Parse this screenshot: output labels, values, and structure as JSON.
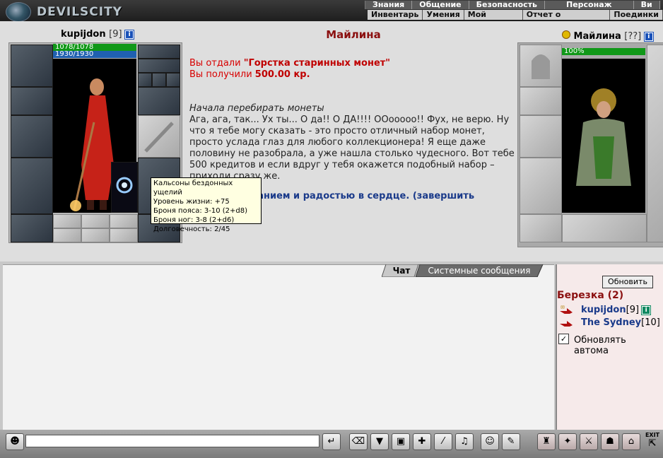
{
  "logo_text": "DEVILSCITY",
  "nav_top": [
    "Знания",
    "Общение",
    "Безопасность",
    "Персонаж",
    "Ви"
  ],
  "nav_sub": [
    "Инвентарь",
    "Умения",
    "Мой Скролл",
    "Отчет о переводах",
    "Поединки"
  ],
  "player": {
    "name": "kupijdon",
    "level": "[9]",
    "hp": "1078/1078",
    "mana": "1930/1930"
  },
  "npc": {
    "name": "Майлина",
    "level": "[??]",
    "hp_percent_label": "100%"
  },
  "tooltip": {
    "title": "Кальсоны бездонных ущелий",
    "lines": [
      "Уровень жизни: +75",
      "Броня пояса: 3-10 (2+d8)",
      "Броня ног: 3-8 (2+d6)",
      "Долговечность: 2/45"
    ]
  },
  "dialog": {
    "title": "Майлина",
    "gave_prefix": "Вы отдали ",
    "gave_item": "\"Горстка старинных монет\"",
    "got_prefix": "Вы получили ",
    "got_amount": "500.00 кр.",
    "action": "Начала перебирать монеты",
    "speech": "Ага, ага, так... Ух ты... О да!! О ДА!!!! ООооооо!! Фух, не верю. Ну что я тебе могу сказать - это просто отличный набор монет, просто услада глаз для любого коллекционера! Я еще даже половину не разобрала, а уже нашла столько чудесного. Вот тебе 500 кредитов и если вдруг у тебя окажется подобный набор – приходи сразу же.",
    "link": "ванием и радостью в сердце. (завершить"
  },
  "chat": {
    "tabs": [
      "Чат",
      "Системные сообщения"
    ]
  },
  "sidebar": {
    "refresh_label": "Обновить",
    "location": "Березка (2)",
    "users": [
      {
        "name": "kupijdon",
        "level": "[9]"
      },
      {
        "name": "The Sydney",
        "level": "[10]"
      }
    ],
    "auto_refresh_label": "Обновлять автома"
  },
  "exit_label": "EXIT"
}
